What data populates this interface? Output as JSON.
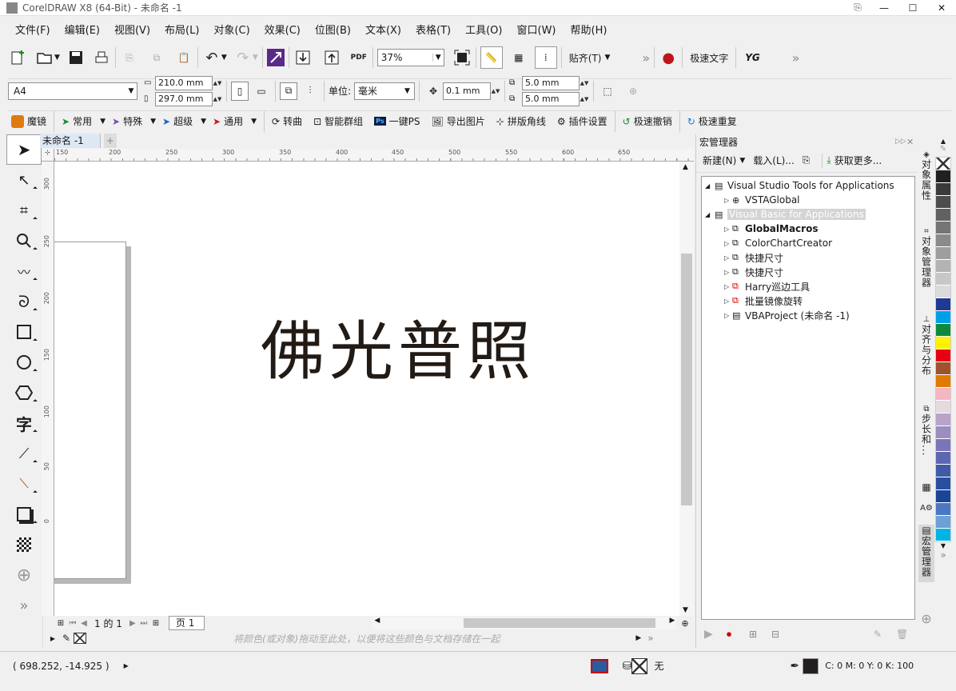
{
  "window": {
    "title": "CorelDRAW X8 (64-Bit) - 未命名 -1"
  },
  "menu": [
    "文件(F)",
    "编辑(E)",
    "视图(V)",
    "布局(L)",
    "对象(C)",
    "效果(C)",
    "位图(B)",
    "文本(X)",
    "表格(T)",
    "工具(O)",
    "窗口(W)",
    "帮助(H)"
  ],
  "toolbar": {
    "zoom": "37%",
    "snap_label": "贴齐(T)",
    "quick_text": "极速文字",
    "pdf_label": "PDF",
    "yg_label": "YG"
  },
  "props": {
    "page_size": "A4",
    "width": "210.0 mm",
    "height": "297.0 mm",
    "unit_label": "单位:",
    "unit": "毫米",
    "nudge": "0.1 mm",
    "dup_x": "5.0 mm",
    "dup_y": "5.0 mm"
  },
  "plugin_bar": [
    "魔镜",
    "常用",
    "特殊",
    "超级",
    "通用",
    "转曲",
    "智能群组",
    "一键PS",
    "导出图片",
    "拼版角线",
    "插件设置",
    "极速撤销",
    "极速重复"
  ],
  "document": {
    "tab": "未命名 -1",
    "canvas_text": "佛光普照",
    "ruler_h": [
      "150",
      "200",
      "250",
      "300",
      "350",
      "400",
      "450",
      "500",
      "550",
      "600",
      "650"
    ],
    "ruler_v": [
      "300",
      "250",
      "200",
      "150",
      "100",
      "50",
      "0"
    ],
    "page_counter": "1 的 1",
    "page_tab": "页 1"
  },
  "palette_hint": "将颜色(或对象)拖动至此处，以便将这些颜色与文档存储在一起",
  "macro_manager": {
    "title": "宏管理器",
    "new_btn": "新建(N)",
    "load_btn": "载入(L)...",
    "get_more": "获取更多...",
    "tree": [
      {
        "label": "Visual Studio Tools for Applications",
        "level": 0,
        "expanded": true
      },
      {
        "label": "VSTAGlobal",
        "level": 1
      },
      {
        "label": "Visual Basic for Applications",
        "level": 0,
        "expanded": true,
        "selected": true
      },
      {
        "label": "GlobalMacros",
        "level": 1,
        "bold": true
      },
      {
        "label": "ColorChartCreator",
        "level": 1
      },
      {
        "label": "快捷尺寸",
        "level": 1
      },
      {
        "label": "快捷尺寸",
        "level": 1
      },
      {
        "label": "Harry巡边工具",
        "level": 1,
        "locked": true
      },
      {
        "label": "批量镜像旋转",
        "level": 1,
        "locked": true
      },
      {
        "label": "VBAProject (未命名 -1)",
        "level": 1
      }
    ]
  },
  "side_tabs": [
    "对象属性",
    "对象管理器",
    "对齐与分布",
    "步长和...",
    "宏管理器"
  ],
  "palette": [
    "#ffffff",
    "#231f20",
    "#3a3a3a",
    "#4d4d4d",
    "#616161",
    "#757575",
    "#8a8a8a",
    "#9e9e9e",
    "#b3b3b3",
    "#c7c7c7",
    "#dbdbdb",
    "#1f3a93",
    "#00a0e9",
    "#0f8a3c",
    "#fff100",
    "#e60012",
    "#a0522d",
    "#e07a00",
    "#f5b6c1",
    "#e8d8e0",
    "#b9a3c8",
    "#9c8dc0",
    "#7b74b8",
    "#5d67b0",
    "#3f5aa8",
    "#2a4f9e",
    "#1a4499",
    "#4a78c2",
    "#6ba0d8",
    "#00b4e6"
  ],
  "status": {
    "coords": "( 698.252, -14.925 )",
    "fill_none": "无",
    "outline": "C: 0 M: 0 Y: 0 K: 100"
  }
}
